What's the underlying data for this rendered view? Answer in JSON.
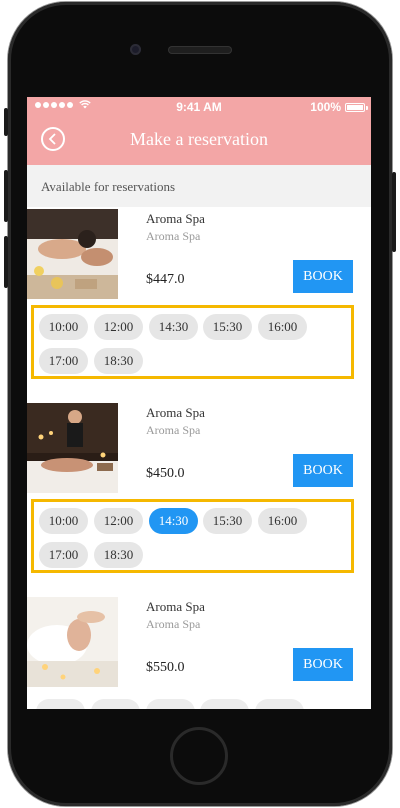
{
  "status_bar": {
    "time": "9:41 AM",
    "battery": "100%"
  },
  "header": {
    "title": "Make a reservation"
  },
  "subheader": {
    "label": "Available for reservations"
  },
  "colors": {
    "header_bg": "#f3a6a6",
    "accent": "#2196f3",
    "highlight_border": "#f5b800"
  },
  "listings": [
    {
      "name": "Aroma Spa",
      "subtitle": "Aroma Spa",
      "price": "$447.0",
      "book_label": "BOOK",
      "slots": [
        "10:00",
        "12:00",
        "14:30",
        "15:30",
        "16:00",
        "17:00",
        "18:30"
      ],
      "selected": null
    },
    {
      "name": "Aroma Spa",
      "subtitle": "Aroma Spa",
      "price": "$450.0",
      "book_label": "BOOK",
      "slots": [
        "10:00",
        "12:00",
        "14:30",
        "15:30",
        "16:00",
        "17:00",
        "18:30"
      ],
      "selected": "14:30"
    },
    {
      "name": "Aroma Spa",
      "subtitle": "Aroma Spa",
      "price": "$550.0",
      "book_label": "BOOK"
    }
  ]
}
